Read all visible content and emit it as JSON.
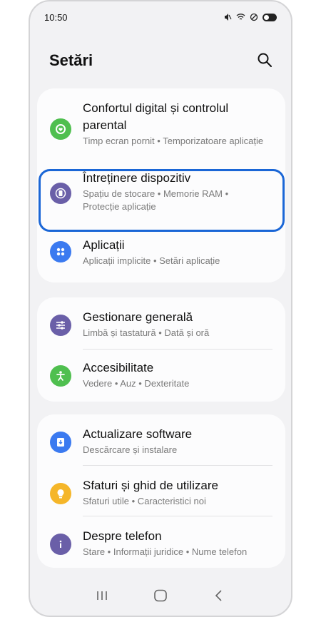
{
  "status_bar": {
    "time": "10:50"
  },
  "header": {
    "title": "Setări"
  },
  "cards": [
    {
      "items": [
        {
          "title": "Confortul digital și controlul parental",
          "subtitle": "Timp ecran pornit  •  Temporizatoare aplicație",
          "icon": "digital-wellbeing-icon",
          "color": "#4fbf4f"
        },
        {
          "title": "Întreținere dispozitiv",
          "subtitle": "Spațiu de stocare  •  Memorie RAM  •  Protecție aplicație",
          "icon": "device-care-icon",
          "color": "#6a5fa8"
        },
        {
          "title": "Aplicații",
          "subtitle": "Aplicații implicite  •  Setări aplicație",
          "icon": "apps-icon",
          "color": "#3b7af0"
        }
      ]
    },
    {
      "items": [
        {
          "title": "Gestionare generală",
          "subtitle": "Limbă și tastatură  •  Dată și oră",
          "icon": "sliders-icon",
          "color": "#6a5fa8"
        },
        {
          "title": "Accesibilitate",
          "subtitle": "Vedere  •  Auz  •  Dexteritate",
          "icon": "accessibility-icon",
          "color": "#4fbf4f"
        }
      ]
    },
    {
      "items": [
        {
          "title": "Actualizare software",
          "subtitle": "Descărcare și instalare",
          "icon": "software-update-icon",
          "color": "#3b7af0"
        },
        {
          "title": "Sfaturi și ghid de utilizare",
          "subtitle": "Sfaturi utile  •  Caracteristici noi",
          "icon": "lightbulb-icon",
          "color": "#f5b629"
        },
        {
          "title": "Despre telefon",
          "subtitle": "Stare  •  Informații juridice  •  Nume telefon",
          "icon": "info-icon",
          "color": "#6a5fa8"
        }
      ]
    }
  ],
  "highlight_color": "#1a66d6"
}
